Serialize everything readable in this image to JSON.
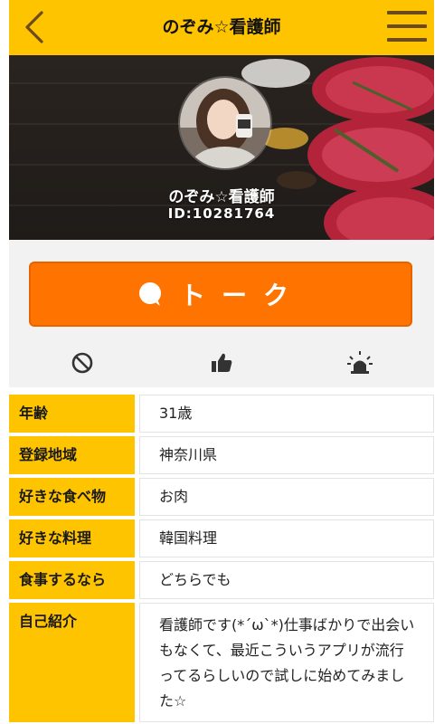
{
  "header": {
    "title": "のぞみ☆看護師",
    "back_icon": "chevron-left-icon",
    "menu_icon": "hamburger-menu-icon"
  },
  "profile": {
    "name": "のぞみ☆看護師",
    "id_text": "ID:10281764"
  },
  "talk_button": {
    "label": "トーク",
    "icon": "speech-bubble-icon"
  },
  "actions": [
    {
      "icon": "block-icon"
    },
    {
      "icon": "thumbs-up-icon"
    },
    {
      "icon": "alarm-light-icon"
    }
  ],
  "details": [
    {
      "label": "年齢",
      "value": "31歳"
    },
    {
      "label": "登録地域",
      "value": "神奈川県"
    },
    {
      "label": "好きな食べ物",
      "value": "お肉"
    },
    {
      "label": "好きな料理",
      "value": "韓国料理"
    },
    {
      "label": "食事するなら",
      "value": "どちらでも"
    },
    {
      "label": "自己紹介",
      "value": "看護師です(*´ω`*)仕事ばかりで出会いもなくて、最近こういうアプリが流行ってるらしいので試しに始めてみました☆"
    }
  ],
  "colors": {
    "header_bg": "#ffc400",
    "talk_button": "#ff7300",
    "label_bg": "#ffc400"
  }
}
